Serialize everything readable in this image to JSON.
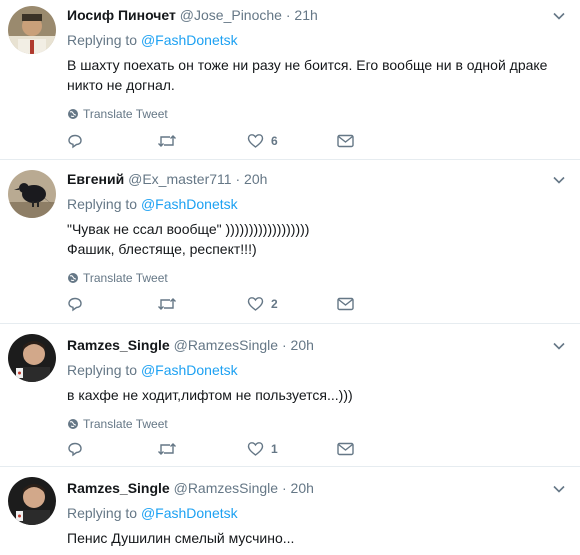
{
  "tweets": [
    {
      "name": "Иосиф Пиночет",
      "handle": "@Jose_Pinoche",
      "time": "21h",
      "replying_prefix": "Replying to",
      "replying_mention": "@FashDonetsk",
      "lines": [
        "В шахту поехать он тоже ни разу не боится. Его вообще ни в одной драке",
        "никто не догнал."
      ],
      "translate": "Translate Tweet",
      "counts": {
        "reply": "",
        "retweet": "",
        "like": "6"
      }
    },
    {
      "name": "Евгений",
      "handle": "@Ex_master711",
      "time": "20h",
      "replying_prefix": "Replying to",
      "replying_mention": "@FashDonetsk",
      "lines": [
        "\"Чувак не ссал вообще\" ))))))))))))))))))",
        "Фашик, блестяще, респект!!!)"
      ],
      "translate": "Translate Tweet",
      "counts": {
        "reply": "",
        "retweet": "",
        "like": "2"
      }
    },
    {
      "name": "Ramzes_Single",
      "handle": "@RamzesSingle",
      "time": "20h",
      "replying_prefix": "Replying to",
      "replying_mention": "@FashDonetsk",
      "lines": [
        "в кахфе не ходит,лифтом не пользуется...)))"
      ],
      "translate": "Translate Tweet",
      "counts": {
        "reply": "",
        "retweet": "",
        "like": "1"
      }
    },
    {
      "name": "Ramzes_Single",
      "handle": "@RamzesSingle",
      "time": "20h",
      "replying_prefix": "Replying to",
      "replying_mention": "@FashDonetsk",
      "lines": [
        "Пенис Душилин смелый мусчино..."
      ]
    }
  ],
  "separator": "·",
  "colors": {
    "accent": "#1da1f2",
    "muted": "#657786",
    "divider": "#e6ecf0"
  }
}
